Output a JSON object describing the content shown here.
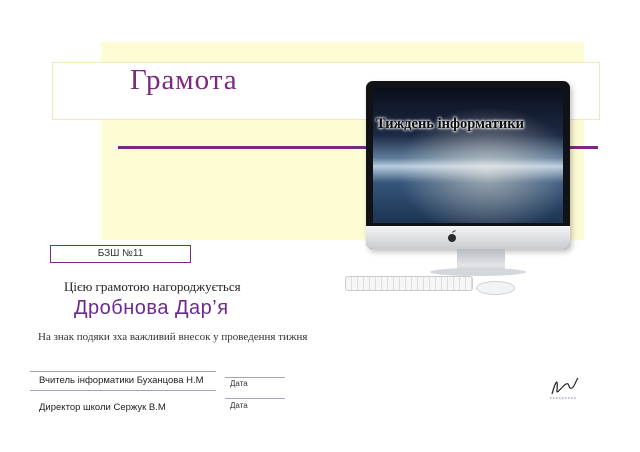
{
  "certificate": {
    "title": "Грамота",
    "school": "БЗШ №11",
    "award_line": "Цією грамотою нагороджується",
    "recipient": "Дробнова Дар’я",
    "reason": "На знак подяки зха важливий внесок у проведення тижня"
  },
  "monitor": {
    "screen_title": "Тиждень інформатики"
  },
  "signatures": [
    {
      "name": "Вчитель інформатики Буханцова Н.М",
      "date_label": "Дата"
    },
    {
      "name": "Директор школи Сержук В.М",
      "date_label": "Дата"
    }
  ],
  "colors": {
    "accent_purple": "#7a2a80",
    "panel_yellow": "#fefcd4"
  }
}
